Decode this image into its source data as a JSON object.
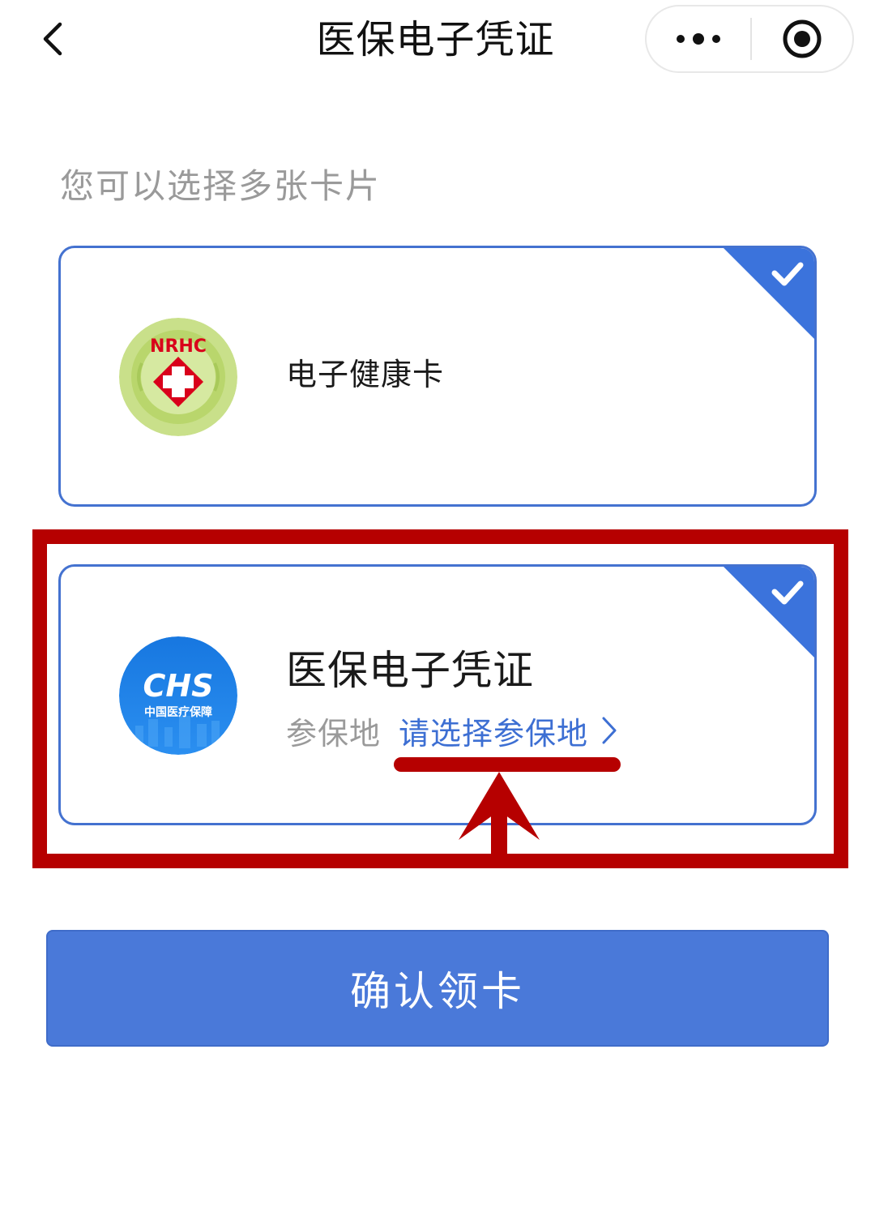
{
  "nav": {
    "title": "医保电子凭证",
    "back_icon": "chevron-left-icon",
    "more_icon": "more-dots-icon",
    "close_icon": "target-circle-icon"
  },
  "hint": "您可以选择多张卡片",
  "cards": [
    {
      "title": "电子健康卡",
      "logo_text": "NRHC",
      "selected": true
    },
    {
      "title": "医保电子凭证",
      "logo_text": "CHS",
      "logo_subtext": "中国医疗保障",
      "region_label": "参保地",
      "region_value": "请选择参保地",
      "selected": true
    }
  ],
  "confirm_button": "确认领卡",
  "colors": {
    "accent": "#4472d0",
    "button": "#4a79d9",
    "link": "#3d6fd3",
    "annotation": "#b60000",
    "muted_text": "#9a9a9a",
    "nrhc_green": "#c9e08a",
    "nrhc_red": "#d9001b",
    "chs_blue": "#1f86e8"
  }
}
